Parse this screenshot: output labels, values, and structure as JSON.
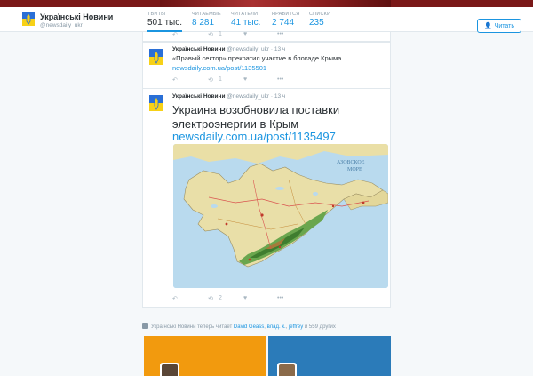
{
  "profile": {
    "name": "Українські Новини",
    "handle": "@newsdaily_ukr"
  },
  "stats": [
    {
      "label": "ТВИТЫ",
      "value": "501 тыс."
    },
    {
      "label": "ЧИТАЕМЫЕ",
      "value": "8 281"
    },
    {
      "label": "ЧИТАТЕЛИ",
      "value": "41 тыс."
    },
    {
      "label": "НРАВИТСЯ",
      "value": "2 744"
    },
    {
      "label": "СПИСКИ",
      "value": "235"
    }
  ],
  "follow_label": "Читать",
  "tweets": [
    {
      "retweets": "1"
    },
    {
      "name": "Українські Новини",
      "handle": "@newsdaily_ukr",
      "time": "· 13 ч",
      "text": "«Правый сектор» прекратил участие в блокаде Крыма",
      "link": "newsdaily.com.ua/post/1135501",
      "retweets": "1"
    },
    {
      "name": "Українські Новини",
      "handle": "@newsdaily_ukr",
      "time": "· 13 ч",
      "text": "Украина возобновила поставки электроэнергии в Крым",
      "link": "newsdaily.com.ua/post/1135497",
      "map_sea_label": "АЗОВСКОЕ МОРЕ",
      "retweets": "2"
    }
  ],
  "notice": {
    "prefix": "Українські Новини теперь читает ",
    "user1": "David Geass",
    "mid1": ", ",
    "user2": "влад. к.",
    "mid2": ", ",
    "user3": "jeffrey",
    "suffix": " и 559 других"
  },
  "colors": {
    "accent": "#1b95e0",
    "banner": "#7a1818",
    "suggestion_orange": "#f29a0e",
    "suggestion_blue": "#2b7bb9"
  }
}
